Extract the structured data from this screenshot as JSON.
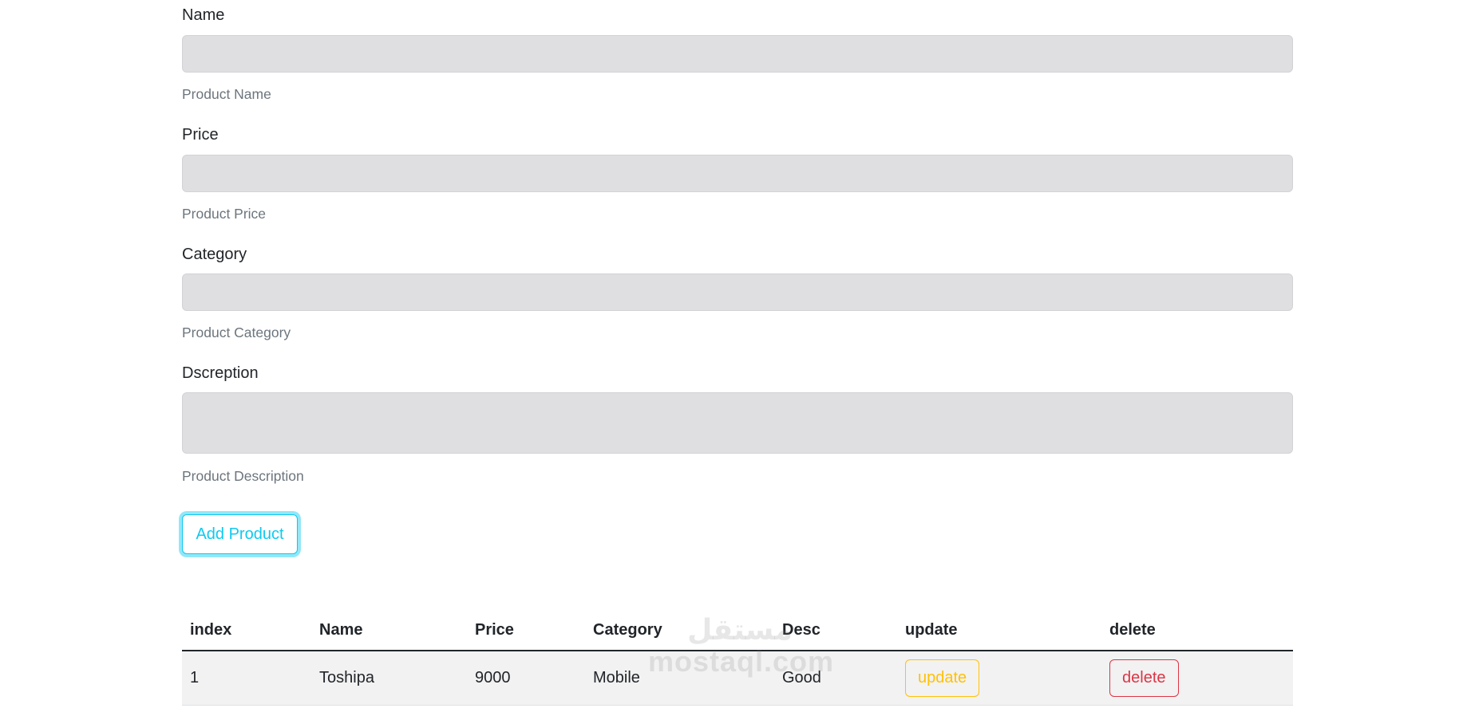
{
  "form": {
    "fields": [
      {
        "label": "Name",
        "help": "Product Name",
        "value": ""
      },
      {
        "label": "Price",
        "help": "Product Price",
        "value": ""
      },
      {
        "label": "Category",
        "help": "Product Category",
        "value": ""
      },
      {
        "label": "Dscreption",
        "help": "Product Description",
        "value": ""
      }
    ],
    "add_button_label": "Add Product"
  },
  "table": {
    "headers": [
      "index",
      "Name",
      "Price",
      "Category",
      "Desc",
      "update",
      "delete"
    ],
    "rows": [
      {
        "index": "1",
        "name": "Toshipa",
        "price": "9000",
        "category": "Mobile",
        "desc": "Good",
        "update_label": "update",
        "delete_label": "delete"
      }
    ]
  },
  "watermark": {
    "line1": "مستقل",
    "line2": "mostaql.com"
  },
  "colors": {
    "info": "#0dcaf0",
    "warning": "#ffc107",
    "danger": "#dc3545",
    "input_bg": "#dfdfe1",
    "help_text": "#6c757d"
  }
}
